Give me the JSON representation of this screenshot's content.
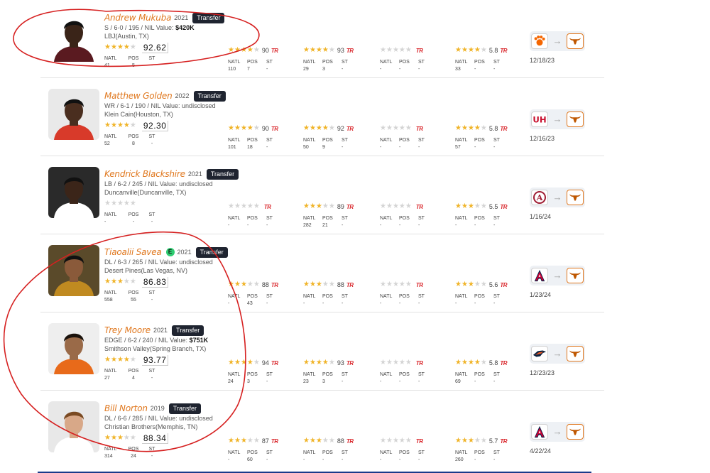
{
  "labels": {
    "natl": "NATL",
    "pos": "POS",
    "st": "ST",
    "tr": "TR",
    "badge": "Transfer",
    "elite": "E",
    "arrow": "→"
  },
  "colors": {
    "name": "#e0781f",
    "star_on": "#f0b429",
    "star_off": "#d4d4d4",
    "tr": "#d9262b",
    "badge_bg": "#1f2430",
    "annotation": "#d62020"
  },
  "players": [
    {
      "name": "Andrew Mukuba",
      "year": "2021",
      "elite": false,
      "detail_prefix": "S / 6-0 / 195 / NIL Value: ",
      "nil": "$420K",
      "school": "LBJ(Austin, TX)",
      "stars": 4,
      "rating": "92.62",
      "ranks": {
        "natl": "41",
        "pos": "5",
        "st": "-"
      },
      "services": [
        {
          "stars": 4,
          "value": "90",
          "natl": "110",
          "pos": "7",
          "st": "-"
        },
        {
          "stars": 4,
          "value": "93",
          "natl": "29",
          "pos": "3",
          "st": "-"
        },
        {
          "stars": 0,
          "value": "",
          "natl": "-",
          "pos": "-",
          "st": "-"
        },
        {
          "stars": 4,
          "value": "5.8",
          "natl": "33",
          "pos": "-",
          "st": "-"
        }
      ],
      "from_logo": "clemson-paw-logo",
      "to_logo": "texas-longhorn-logo",
      "date": "12/18/23"
    },
    {
      "name": "Matthew Golden",
      "year": "2022",
      "elite": false,
      "detail_prefix": "WR / 6-1 / 190 / NIL Value: ",
      "nil": "undisclosed",
      "school": "Klein Cain(Houston, TX)",
      "stars": 4,
      "rating": "92.30",
      "ranks": {
        "natl": "52",
        "pos": "8",
        "st": "-"
      },
      "services": [
        {
          "stars": 4,
          "value": "90",
          "natl": "101",
          "pos": "18",
          "st": "-"
        },
        {
          "stars": 4,
          "value": "92",
          "natl": "50",
          "pos": "9",
          "st": "-"
        },
        {
          "stars": 0,
          "value": "",
          "natl": "-",
          "pos": "-",
          "st": "-"
        },
        {
          "stars": 4,
          "value": "5.8",
          "natl": "57",
          "pos": "-",
          "st": "-"
        }
      ],
      "from_logo": "houston-uh-logo",
      "to_logo": "texas-longhorn-logo",
      "date": "12/16/23"
    },
    {
      "name": "Kendrick Blackshire",
      "year": "2021",
      "elite": false,
      "detail_prefix": "LB / 6-2 / 245 / NIL Value: ",
      "nil": "undisclosed",
      "school": "Duncanville(Duncanville, TX)",
      "stars": 0,
      "rating": "",
      "ranks": {
        "natl": "-",
        "pos": "-",
        "st": "-"
      },
      "services": [
        {
          "stars": 0,
          "value": "",
          "natl": "-",
          "pos": "-",
          "st": "-"
        },
        {
          "stars": 3,
          "value": "89",
          "natl": "282",
          "pos": "21",
          "st": "-"
        },
        {
          "stars": 0,
          "value": "",
          "natl": "-",
          "pos": "-",
          "st": "-"
        },
        {
          "stars": 3,
          "value": "5.5",
          "natl": "-",
          "pos": "-",
          "st": "-"
        }
      ],
      "from_logo": "alabama-a-logo",
      "to_logo": "texas-longhorn-logo",
      "date": "1/16/24"
    },
    {
      "name": "Tiaoalii Savea",
      "year": "2021",
      "elite": true,
      "detail_prefix": "DL / 6-3 / 265 / NIL Value: ",
      "nil": "undisclosed",
      "school": "Desert Pines(Las Vegas, NV)",
      "stars": 3,
      "rating": "86.83",
      "ranks": {
        "natl": "558",
        "pos": "55",
        "st": "-"
      },
      "services": [
        {
          "stars": 3,
          "value": "88",
          "natl": "-",
          "pos": "43",
          "st": "-"
        },
        {
          "stars": 3,
          "value": "88",
          "natl": "-",
          "pos": "-",
          "st": "-"
        },
        {
          "stars": 0,
          "value": "",
          "natl": "-",
          "pos": "-",
          "st": "-"
        },
        {
          "stars": 3,
          "value": "5.6",
          "natl": "-",
          "pos": "-",
          "st": "-"
        }
      ],
      "from_logo": "arizona-a-logo",
      "to_logo": "texas-longhorn-logo",
      "date": "1/23/24"
    },
    {
      "name": "Trey Moore",
      "year": "2021",
      "elite": false,
      "detail_prefix": "EDGE / 6-2 / 240 / NIL Value: ",
      "nil": "$751K",
      "school": "Smithson Valley(Spring Branch, TX)",
      "stars": 4,
      "rating": "93.77",
      "ranks": {
        "natl": "27",
        "pos": "4",
        "st": "-"
      },
      "services": [
        {
          "stars": 4,
          "value": "94",
          "natl": "24",
          "pos": "3",
          "st": "-"
        },
        {
          "stars": 4,
          "value": "93",
          "natl": "23",
          "pos": "3",
          "st": "-"
        },
        {
          "stars": 0,
          "value": "",
          "natl": "-",
          "pos": "-",
          "st": "-"
        },
        {
          "stars": 4,
          "value": "5.8",
          "natl": "69",
          "pos": "-",
          "st": "-"
        }
      ],
      "from_logo": "utsa-roadrunner-logo",
      "to_logo": "texas-longhorn-logo",
      "date": "12/23/23"
    },
    {
      "name": "Bill Norton",
      "year": "2019",
      "elite": false,
      "detail_prefix": "DL / 6-6 / 285 / NIL Value: ",
      "nil": "undisclosed",
      "school": "Christian Brothers(Memphis, TN)",
      "stars": 3,
      "rating": "88.34",
      "ranks": {
        "natl": "314",
        "pos": "24",
        "st": "-"
      },
      "services": [
        {
          "stars": 3,
          "value": "87",
          "natl": "-",
          "pos": "60",
          "st": "-"
        },
        {
          "stars": 3,
          "value": "88",
          "natl": "-",
          "pos": "-",
          "st": "-"
        },
        {
          "stars": 0,
          "value": "",
          "natl": "-",
          "pos": "-",
          "st": "-"
        },
        {
          "stars": 3,
          "value": "5.7",
          "natl": "260",
          "pos": "-",
          "st": "-"
        }
      ],
      "from_logo": "arizona-a-logo",
      "to_logo": "texas-longhorn-logo",
      "date": "4/22/24"
    }
  ]
}
